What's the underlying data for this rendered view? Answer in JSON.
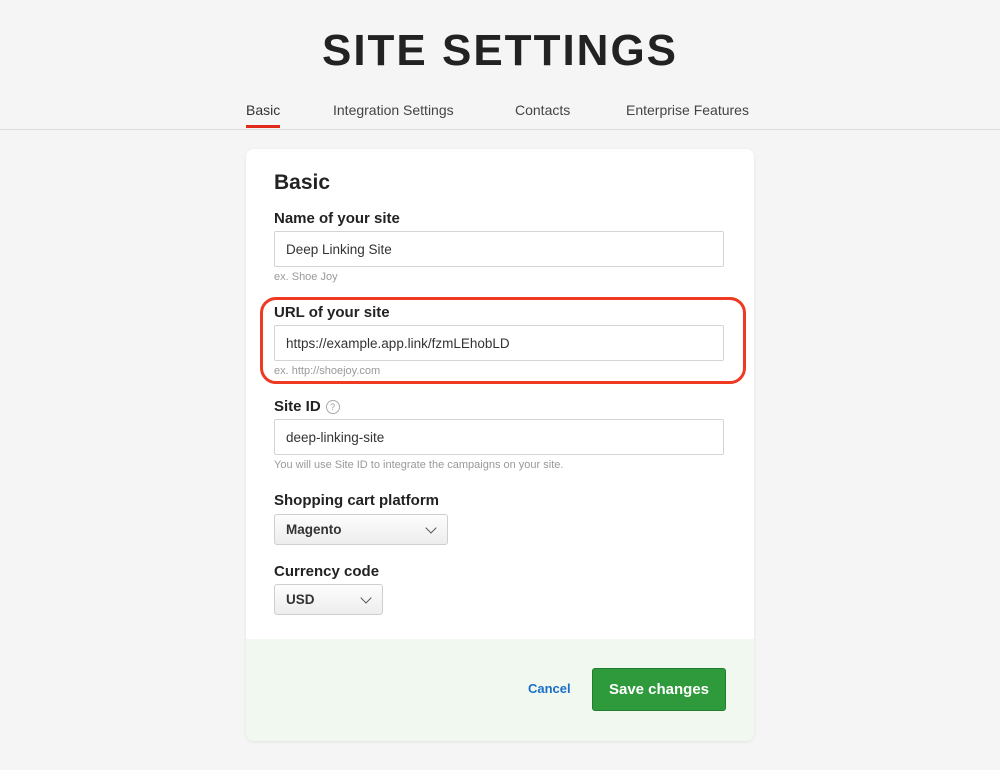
{
  "page": {
    "title": "SITE SETTINGS"
  },
  "tabs": [
    {
      "label": "Basic",
      "active": true
    },
    {
      "label": "Integration Settings",
      "active": false
    },
    {
      "label": "Contacts",
      "active": false
    },
    {
      "label": "Enterprise Features",
      "active": false
    }
  ],
  "form": {
    "section_title": "Basic",
    "site_name": {
      "label": "Name of your site",
      "value": "Deep Linking Site",
      "hint": "ex. Shoe Joy"
    },
    "site_url": {
      "label": "URL of your site",
      "value": "https://example.app.link/fzmLEhobLD",
      "hint": "ex. http://shoejoy.com"
    },
    "site_id": {
      "label": "Site ID",
      "help_icon": "?",
      "value": "deep-linking-site",
      "hint": "You will use Site ID to integrate the campaigns on your site."
    },
    "cart_platform": {
      "label": "Shopping cart platform",
      "selected": "Magento"
    },
    "currency": {
      "label": "Currency code",
      "selected": "USD"
    }
  },
  "actions": {
    "cancel_label": "Cancel",
    "save_label": "Save changes"
  },
  "colors": {
    "accent": "#e02a1b",
    "highlight": "#ee3a22",
    "save": "#2f9a3c",
    "link": "#1a6fc9",
    "footer_bg": "#f0f8f0"
  }
}
